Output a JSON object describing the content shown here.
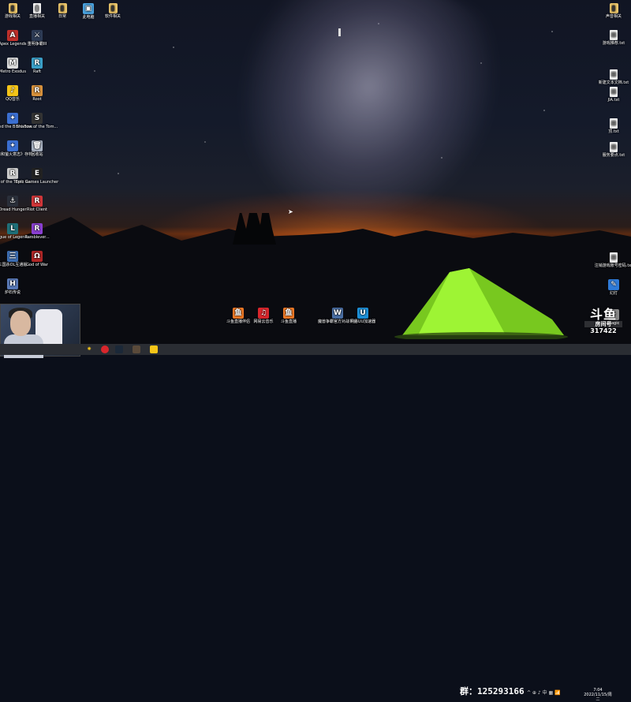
{
  "desktop": {
    "left_icons": [
      {
        "label": "游戏相关",
        "glyph": "▮",
        "kind": "folderdoc",
        "color": "#e9c46a"
      },
      {
        "label": "直播相关",
        "glyph": "▮",
        "kind": "doc",
        "color": "#f2f2f2"
      },
      {
        "label": "日常",
        "glyph": "▮",
        "kind": "folderdoc",
        "color": "#e9c46a"
      },
      {
        "label": "此电脑",
        "glyph": "▣",
        "kind": "app",
        "color": "#4aa3df"
      },
      {
        "label": "软件相关",
        "glyph": "▮",
        "kind": "folderdoc",
        "color": "#e9c46a"
      },
      {
        "label": "Apex Legends",
        "glyph": "A",
        "kind": "app",
        "color": "#c0302b"
      },
      {
        "label": "重明争霸III",
        "glyph": "⚔",
        "kind": "app",
        "color": "#2d3b55"
      },
      {
        "label": "Metro Exodus",
        "glyph": "M",
        "kind": "app",
        "color": "#ddd"
      },
      {
        "label": "Raft",
        "glyph": "R",
        "kind": "app",
        "color": "#3aa0c8"
      },
      {
        "label": "QQ音乐",
        "glyph": "♪",
        "kind": "app",
        "color": "#f5c518"
      },
      {
        "label": "Root",
        "glyph": "R",
        "kind": "app",
        "color": "#d7913c"
      },
      {
        "label": "Ori and the Blind Fore...",
        "glyph": "✦",
        "kind": "app",
        "color": "#3b6fd1"
      },
      {
        "label": "Shadow of the Tom...",
        "glyph": "S",
        "kind": "app",
        "color": "#333"
      },
      {
        "label": "《奥日和萤火意志》存档...",
        "glyph": "✦",
        "kind": "app",
        "color": "#3b6fd1"
      },
      {
        "label": "回收站",
        "glyph": "🗑",
        "kind": "app",
        "color": "#aab4c3"
      },
      {
        "label": "Rise of the Tomb Ra...",
        "glyph": "R",
        "kind": "app",
        "color": "#ccc"
      },
      {
        "label": "Epic Games Launcher",
        "glyph": "E",
        "kind": "app",
        "color": "#222"
      },
      {
        "label": "Dread Hunger",
        "glyph": "⚓",
        "kind": "app",
        "color": "#2a2f3a"
      },
      {
        "label": "Riot Client",
        "glyph": "R",
        "kind": "app",
        "color": "#d13639"
      },
      {
        "label": "League of Legends...",
        "glyph": "L",
        "kind": "app",
        "color": "#1f6f78"
      },
      {
        "label": "Rumblever...",
        "glyph": "R",
        "kind": "app",
        "color": "#8a3fd1"
      },
      {
        "label": "三国杀OL互通版",
        "glyph": "三",
        "kind": "app",
        "color": "#3d6fb5"
      },
      {
        "label": "God of War",
        "glyph": "Ω",
        "kind": "app",
        "color": "#b02626"
      },
      {
        "label": "炉石传说",
        "glyph": "H",
        "kind": "app",
        "color": "#5a7ab8"
      }
    ],
    "right_icons": [
      {
        "label": "声音相关",
        "glyph": "▮",
        "kind": "folderdoc",
        "color": "#e9c46a"
      },
      {
        "label": "游戏推荐.txt",
        "glyph": "≡",
        "kind": "doc",
        "color": "#f2f2f2"
      },
      {
        "label": "新建文本文档.txt",
        "glyph": "≡",
        "kind": "doc",
        "color": "#f2f2f2"
      },
      {
        "label": "JIA.txt",
        "glyph": "≡",
        "kind": "doc",
        "color": "#f2f2f2"
      },
      {
        "label": "顶.txt",
        "glyph": "≡",
        "kind": "doc",
        "color": "#f2f2f2"
      },
      {
        "label": "服务要点.txt",
        "glyph": "≡",
        "kind": "doc",
        "color": "#f2f2f2"
      },
      {
        "label": "注销游戏账号密码.txt",
        "glyph": "≡",
        "kind": "doc",
        "color": "#f2f2f2"
      },
      {
        "label": "幻灯",
        "glyph": "✎",
        "kind": "app",
        "color": "#2f7bd9"
      },
      {
        "label": "Magic",
        "glyph": "✦",
        "kind": "app",
        "color": "#888"
      }
    ],
    "bottom_icons": [
      {
        "label": "斗鱼直播伴侣",
        "glyph": "鱼",
        "kind": "app",
        "color": "#f07a26"
      },
      {
        "label": "网易云音乐",
        "glyph": "♫",
        "kind": "app",
        "color": "#d9262c"
      },
      {
        "label": "斗鱼直播",
        "glyph": "鱼",
        "kind": "app",
        "color": "#f07a26"
      },
      {
        "label": "魔兽争霸官方对战平台",
        "glyph": "W",
        "kind": "app",
        "color": "#4a6fa5"
      },
      {
        "label": "网易UU加速器",
        "glyph": "U",
        "kind": "app",
        "color": "#1d8fd6"
      }
    ],
    "selected_file_label": "    "
  },
  "watermark": {
    "logo": "斗鱼",
    "room_label": "房间号",
    "room_number": "317422"
  },
  "taskbar": {
    "group_label": "群：125293166",
    "tray_icons": "^ ⊕ ♪ 中 ▦ 📶",
    "clock_time": "7:04",
    "clock_date": "2022/11/15/周二"
  }
}
